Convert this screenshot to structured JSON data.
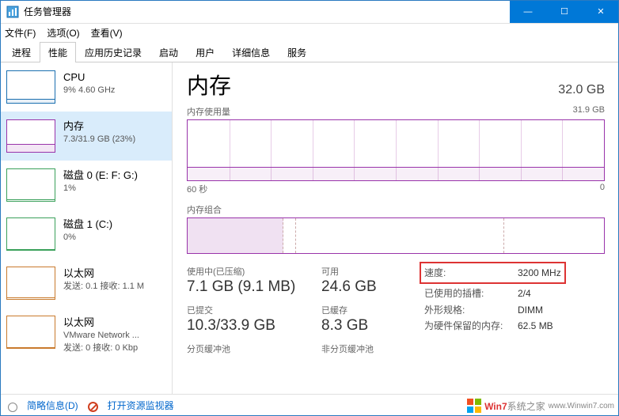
{
  "window": {
    "title": "任务管理器",
    "min": "—",
    "max": "☐",
    "close": "✕"
  },
  "menu": {
    "file": "文件(F)",
    "options": "选项(O)",
    "view": "查看(V)"
  },
  "tabs": {
    "processes": "进程",
    "performance": "性能",
    "history": "应用历史记录",
    "startup": "启动",
    "users": "用户",
    "details": "详细信息",
    "services": "服务"
  },
  "sidebar": {
    "cpu": {
      "name": "CPU",
      "sub": "9% 4.60 GHz"
    },
    "mem": {
      "name": "内存",
      "sub": "7.3/31.9 GB (23%)"
    },
    "disk0": {
      "name": "磁盘 0 (E: F: G:)",
      "sub": "1%"
    },
    "disk1": {
      "name": "磁盘 1 (C:)",
      "sub": "0%"
    },
    "eth0": {
      "name": "以太网",
      "sub": "发送: 0.1 接收: 1.1 M"
    },
    "eth1": {
      "name": "以太网",
      "sub2": "VMware Network ...",
      "sub": "发送: 0 接收: 0 Kbp"
    }
  },
  "main": {
    "title": "内存",
    "total": "32.0 GB",
    "usage_label": "内存使用量",
    "usage_max": "31.9 GB",
    "axis_left": "60 秒",
    "axis_right": "0",
    "comp_label": "内存组合"
  },
  "stats": {
    "inuse_lbl": "使用中(已压缩)",
    "inuse_val": "7.1 GB (9.1 MB)",
    "avail_lbl": "可用",
    "avail_val": "24.6 GB",
    "commit_lbl": "已提交",
    "commit_val": "10.3/33.9 GB",
    "cached_lbl": "已缓存",
    "cached_val": "8.3 GB",
    "paged_lbl": "分页缓冲池",
    "nonpaged_lbl": "非分页缓冲池"
  },
  "details": {
    "speed_k": "速度:",
    "speed_v": "3200 MHz",
    "slots_k": "已使用的插槽:",
    "slots_v": "2/4",
    "form_k": "外形规格:",
    "form_v": "DIMM",
    "reserved_k": "为硬件保留的内存:",
    "reserved_v": "62.5 MB"
  },
  "footer": {
    "brief": "简略信息(D)",
    "resmon": "打开资源监视器"
  },
  "watermark": {
    "a": "Win7",
    "b": "系统之家",
    "url": "www.Winwin7.com"
  },
  "chart_data": {
    "type": "area",
    "title": "内存使用量",
    "xlabel": "秒",
    "ylabel": "GB",
    "x_range": [
      60,
      0
    ],
    "ylim": [
      0,
      31.9
    ],
    "series": [
      {
        "name": "使用中",
        "approx_level_gb": 7.3,
        "percent": 23
      }
    ],
    "composition": {
      "segments_percent": [
        23,
        3,
        50,
        24
      ]
    }
  }
}
